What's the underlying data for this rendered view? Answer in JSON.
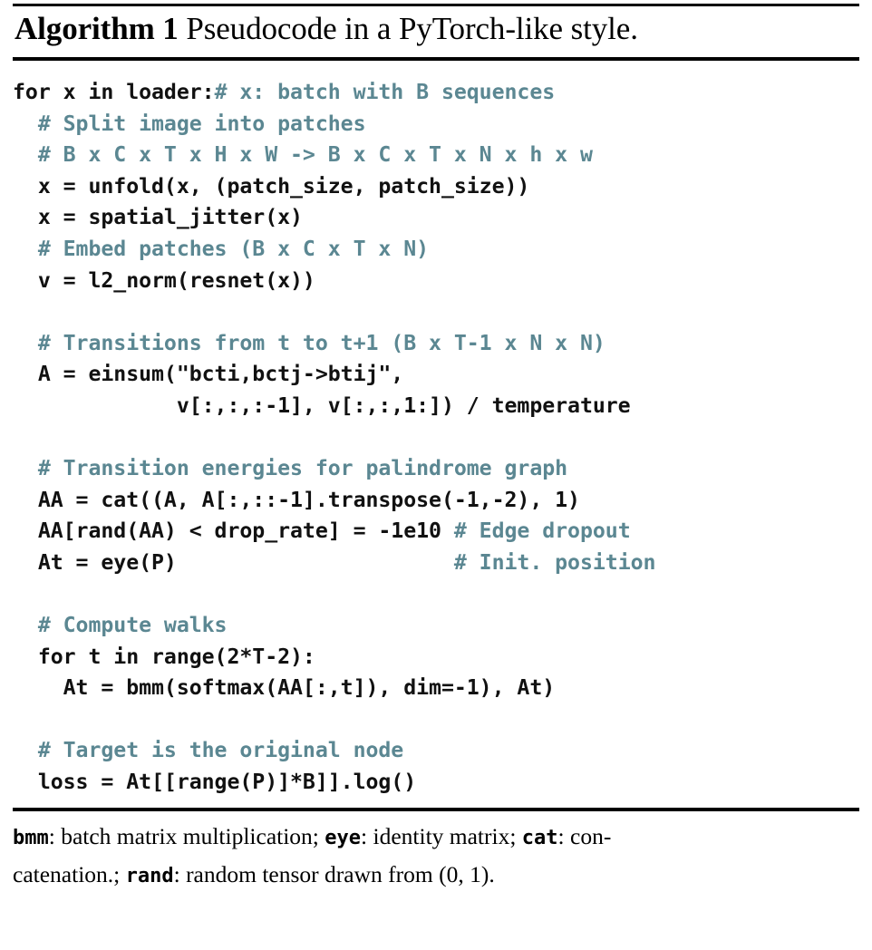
{
  "figure": {
    "kind": "algorithm-listing",
    "colors": {
      "background": "#ffffff",
      "code_text": "#111111",
      "comment_text": "#5b8792",
      "rule": "#000000"
    }
  },
  "title": {
    "label": "Algorithm 1",
    "caption": "Pseudocode in a PyTorch-like style.",
    "full": "Algorithm 1 Pseudocode in a PyTorch-like style."
  },
  "code": {
    "language": "python-pseudocode",
    "lines": [
      {
        "indent": 0,
        "code": "for x in loader:",
        "comment": "# x: batch with B sequences",
        "gap": 1
      },
      {
        "indent": 2,
        "code": "",
        "comment": "# Split image into patches"
      },
      {
        "indent": 2,
        "code": "",
        "comment": "# B x C x T x H x W -> B x C x T x N x h x w"
      },
      {
        "indent": 2,
        "code": "x = unfold(x, (patch_size, patch_size))",
        "comment": ""
      },
      {
        "indent": 2,
        "code": "x = spatial_jitter(x)",
        "comment": ""
      },
      {
        "indent": 2,
        "code": "",
        "comment": "# Embed patches (B x C x T x N)"
      },
      {
        "indent": 2,
        "code": "v = l2_norm(resnet(x))",
        "comment": ""
      },
      {
        "blank": true
      },
      {
        "indent": 2,
        "code": "",
        "comment": "# Transitions from t to t+1 (B x T-1 x N x N)"
      },
      {
        "indent": 2,
        "code": "A = einsum(\"bcti,bctj->btij\",",
        "comment": ""
      },
      {
        "indent": 13,
        "code": "v[:,:,:-1], v[:,:,1:]) / temperature",
        "comment": ""
      },
      {
        "blank": true
      },
      {
        "indent": 2,
        "code": "",
        "comment": "# Transition energies for palindrome graph"
      },
      {
        "indent": 2,
        "code": "AA = cat((A, A[:,::-1].transpose(-1,-2), 1)",
        "comment": ""
      },
      {
        "indent": 2,
        "code": "AA[rand(AA) < drop_rate] = -1e10 ",
        "comment": "# Edge dropout"
      },
      {
        "indent": 2,
        "code": "At = eye(P)                      ",
        "comment": "# Init. position"
      },
      {
        "blank": true
      },
      {
        "indent": 2,
        "code": "",
        "comment": "# Compute walks"
      },
      {
        "indent": 2,
        "code": "for t in range(2*T-2):",
        "comment": ""
      },
      {
        "indent": 4,
        "code": "At = bmm(softmax(AA[:,t]), dim=-1), At)",
        "comment": ""
      },
      {
        "blank": true
      },
      {
        "indent": 2,
        "code": "",
        "comment": "# Target is the original node"
      },
      {
        "indent": 2,
        "code": "loss = At[[range(P)]*B]].log()",
        "comment": ""
      }
    ]
  },
  "footer": {
    "segments": [
      {
        "text": "bmm",
        "style": "mono"
      },
      {
        "text": ": batch matrix multiplication; ",
        "style": "serif"
      },
      {
        "text": "eye",
        "style": "mono"
      },
      {
        "text": ": identity matrix; ",
        "style": "serif"
      },
      {
        "text": "cat",
        "style": "mono"
      },
      {
        "text": ": con-",
        "style": "serif"
      },
      {
        "text": "\n",
        "style": "break"
      },
      {
        "text": "catenation.; ",
        "style": "serif"
      },
      {
        "text": "rand",
        "style": "mono"
      },
      {
        "text": ": random tensor drawn from ",
        "style": "serif"
      },
      {
        "text": "(0, 1)",
        "style": "mathnum"
      },
      {
        "text": ".",
        "style": "serif"
      }
    ],
    "plain_text": "bmm: batch matrix multiplication; eye: identity matrix; cat: concatenation.; rand: random tensor drawn from (0, 1)."
  }
}
